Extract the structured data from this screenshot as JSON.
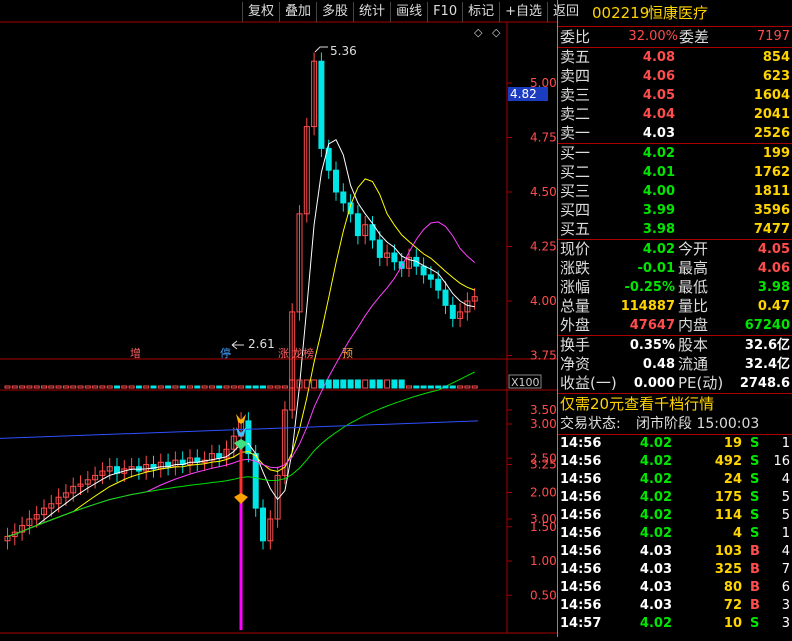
{
  "toolbar": [
    "复权",
    "叠加",
    "多股",
    "统计",
    "画线",
    "F10",
    "标记",
    "+自选",
    "返回"
  ],
  "stock": {
    "code": "002219",
    "name": "恒康医疗"
  },
  "price_axis": {
    "ticks": [
      "5.00",
      "4.75",
      "4.50",
      "4.25",
      "4.00",
      "3.75",
      "3.50",
      "3.25",
      "3.00"
    ],
    "current": "4.82"
  },
  "annotations": {
    "high": "5.36",
    "low": "2.61"
  },
  "tags": [
    "增",
    "停",
    "涨",
    "龙榜",
    "预"
  ],
  "volume_axis": {
    "label": "X100"
  },
  "indicator_axis": {
    "ticks": [
      "3.00",
      "2.50",
      "2.00",
      "1.50",
      "1.00",
      "0.50"
    ]
  },
  "orderbook": {
    "weibi": {
      "label": "委比",
      "value": "32.00%",
      "label2": "委差",
      "value2": "7197"
    },
    "sells": [
      {
        "label": "卖五",
        "price": "4.08",
        "vol": "854"
      },
      {
        "label": "卖四",
        "price": "4.06",
        "vol": "623"
      },
      {
        "label": "卖三",
        "price": "4.05",
        "vol": "1604"
      },
      {
        "label": "卖二",
        "price": "4.04",
        "vol": "2041"
      },
      {
        "label": "卖一",
        "price": "4.03",
        "vol": "2526"
      }
    ],
    "buys": [
      {
        "label": "买一",
        "price": "4.02",
        "vol": "199"
      },
      {
        "label": "买二",
        "price": "4.01",
        "vol": "1762"
      },
      {
        "label": "买三",
        "price": "4.00",
        "vol": "1811"
      },
      {
        "label": "买四",
        "price": "3.99",
        "vol": "3596"
      },
      {
        "label": "买五",
        "price": "3.98",
        "vol": "7477"
      }
    ]
  },
  "quote": [
    {
      "l1": "现价",
      "v1": "4.02",
      "l2": "今开",
      "v2": "4.05"
    },
    {
      "l1": "涨跌",
      "v1": "-0.01",
      "l2": "最高",
      "v2": "4.06"
    },
    {
      "l1": "涨幅",
      "v1": "-0.25%",
      "l2": "最低",
      "v2": "3.98"
    },
    {
      "l1": "总量",
      "v1": "114887",
      "l2": "量比",
      "v2": "0.47"
    },
    {
      "l1": "外盘",
      "v1": "47647",
      "l2": "内盘",
      "v2": "67240"
    }
  ],
  "fundamentals": [
    {
      "l1": "换手",
      "v1": "0.35%",
      "l2": "股本",
      "v2": "32.6亿"
    },
    {
      "l1": "净资",
      "v1": "0.48",
      "l2": "流通",
      "v2": "32.4亿"
    },
    {
      "l1": "收益(一)",
      "v1": "0.000",
      "l2": "PE(动)",
      "v2": "2748.6"
    }
  ],
  "promo": "仅需20元查看千档行情",
  "status": {
    "label": "交易状态:",
    "value": "闭市阶段 15:00:03"
  },
  "ticks": [
    {
      "t": "14:56",
      "p": "4.02",
      "v": "19",
      "d": "S",
      "n": "1"
    },
    {
      "t": "14:56",
      "p": "4.02",
      "v": "492",
      "d": "S",
      "n": "16"
    },
    {
      "t": "14:56",
      "p": "4.02",
      "v": "24",
      "d": "S",
      "n": "4"
    },
    {
      "t": "14:56",
      "p": "4.02",
      "v": "175",
      "d": "S",
      "n": "5"
    },
    {
      "t": "14:56",
      "p": "4.02",
      "v": "114",
      "d": "S",
      "n": "5"
    },
    {
      "t": "14:56",
      "p": "4.02",
      "v": "4",
      "d": "S",
      "n": "1"
    },
    {
      "t": "14:56",
      "p": "4.03",
      "v": "103",
      "d": "B",
      "n": "4"
    },
    {
      "t": "14:56",
      "p": "4.03",
      "v": "325",
      "d": "B",
      "n": "7"
    },
    {
      "t": "14:56",
      "p": "4.03",
      "v": "80",
      "d": "B",
      "n": "6"
    },
    {
      "t": "14:56",
      "p": "4.03",
      "v": "72",
      "d": "B",
      "n": "3"
    },
    {
      "t": "14:57",
      "p": "4.02",
      "v": "10",
      "d": "S",
      "n": "3"
    }
  ],
  "colors": {
    "up": "#ff4d4d",
    "down": "#00e600",
    "border": "#a00000",
    "accent": "#ffd400"
  }
}
